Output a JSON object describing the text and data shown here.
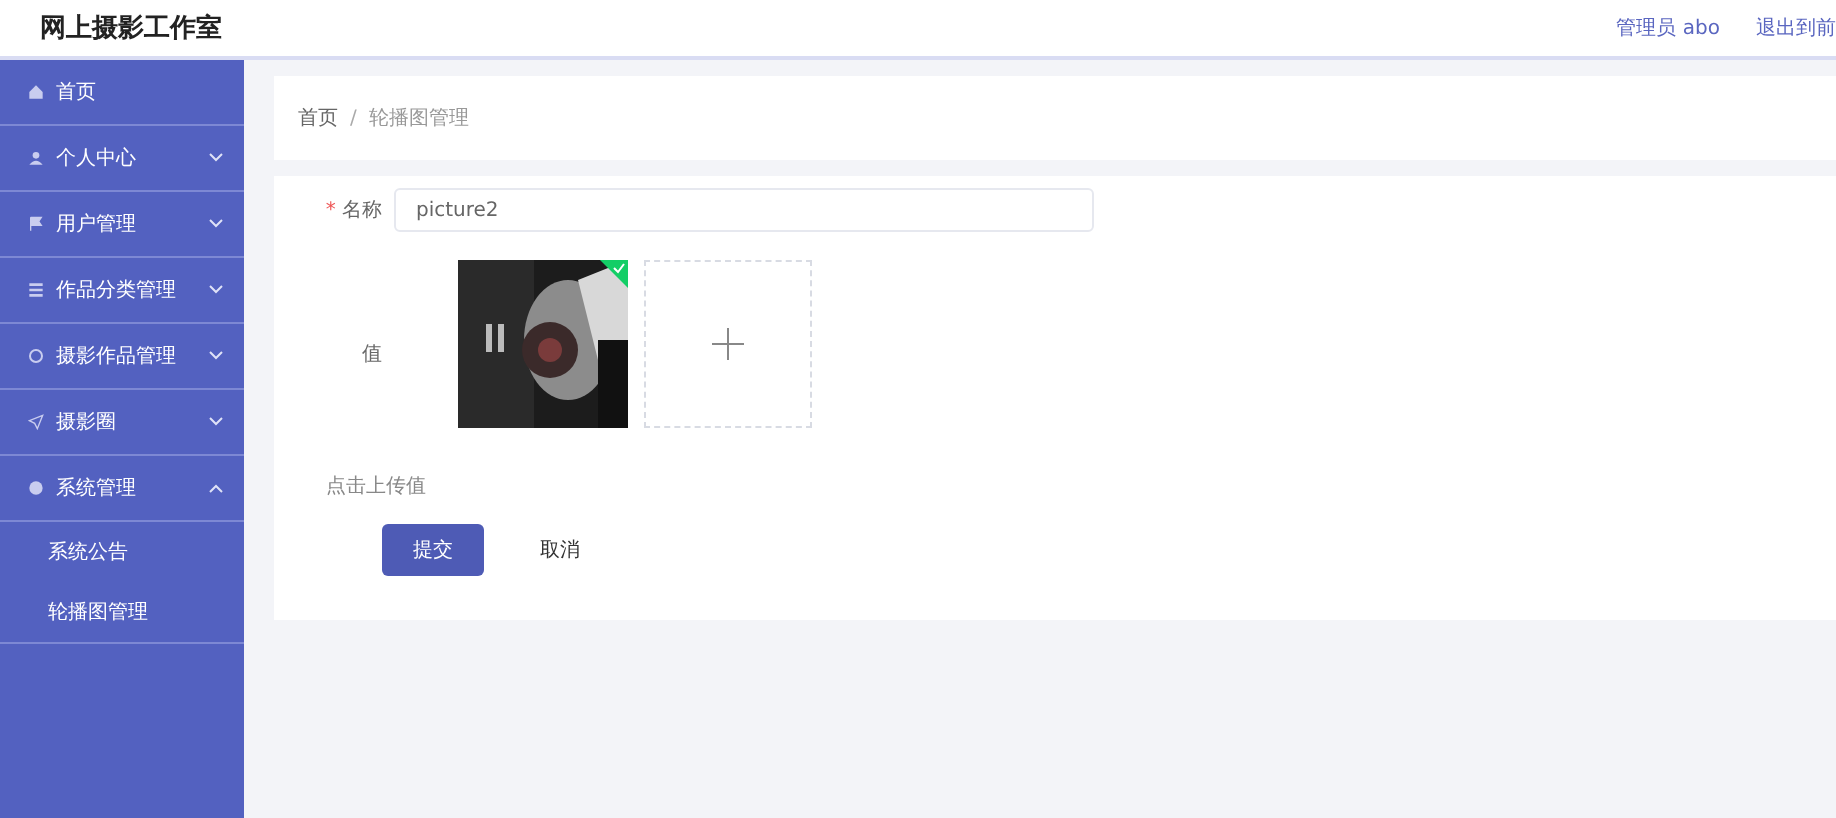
{
  "header": {
    "title": "网上摄影工作室",
    "user": "管理员 abo",
    "logout": "退出到前"
  },
  "sidebar": {
    "items": [
      {
        "label": "首页"
      },
      {
        "label": "个人中心",
        "expanded": false
      },
      {
        "label": "用户管理",
        "expanded": false
      },
      {
        "label": "作品分类管理",
        "expanded": false
      },
      {
        "label": "摄影作品管理",
        "expanded": false
      },
      {
        "label": "摄影圈",
        "expanded": false
      },
      {
        "label": "系统管理",
        "expanded": true,
        "children": [
          {
            "label": "系统公告"
          },
          {
            "label": "轮播图管理"
          }
        ]
      }
    ]
  },
  "breadcrumb": {
    "separator": "/",
    "items": [
      "首页",
      "轮播图管理"
    ]
  },
  "form": {
    "required_mark": "*",
    "name_label": "名称",
    "name_value": "picture2",
    "value_label": "值",
    "uploads": [
      {
        "kind": "picture",
        "uploaded": true
      }
    ],
    "hint": "点击上传值",
    "submit": "提交",
    "cancel": "取消"
  }
}
